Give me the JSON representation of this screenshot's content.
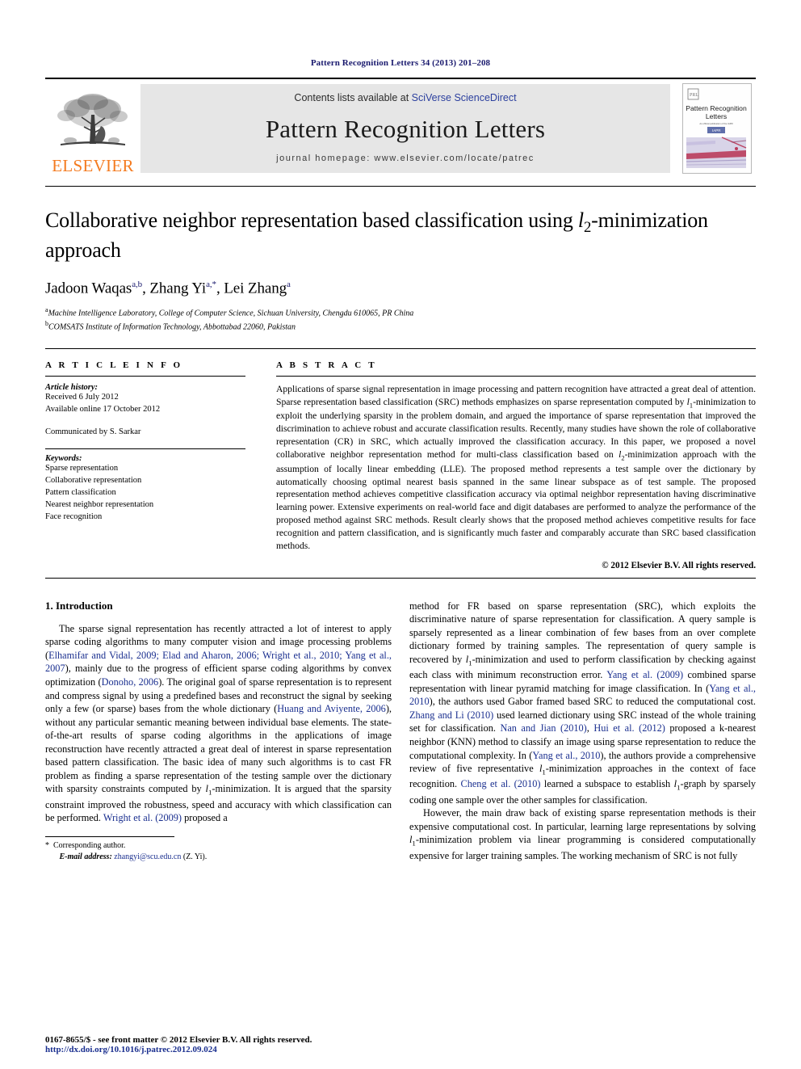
{
  "running_head": "Pattern Recognition Letters 34 (2013) 201–208",
  "masthead": {
    "contents_prefix": "Contents lists available at ",
    "sciencedirect_link": "SciVerse ScienceDirect",
    "journal_name": "Pattern Recognition Letters",
    "homepage": "journal homepage: www.elsevier.com/locate/patrec",
    "publisher_wordmark": "ELSEVIER",
    "cover_title_line1": "Pattern Recognition",
    "cover_title_line2": "Letters"
  },
  "article": {
    "title": "Collaborative neighbor representation based classification using l2-minimization approach",
    "title_part1": "Collaborative neighbor representation based classification using ",
    "title_math": "l",
    "title_sub": "2",
    "title_part2": "-minimization approach",
    "authors": "Jadoon Waqas a,b, Zhang Yi a,*, Lei Zhang a",
    "author1": "Jadoon Waqas",
    "author1_sup": "a,b",
    "author2": "Zhang Yi",
    "author2_sup": "a,*",
    "author3": "Lei Zhang",
    "author3_sup": "a",
    "affiliation_a_sup": "a",
    "affiliation_a": "Machine Intelligence Laboratory, College of Computer Science, Sichuan University, Chengdu 610065, PR China",
    "affiliation_b_sup": "b",
    "affiliation_b": "COMSATS Institute of Information Technology, Abbottabad 22060, Pakistan"
  },
  "article_info": {
    "heading": "A R T I C L E   I N F O",
    "history_label": "Article history:",
    "received": "Received 6 July 2012",
    "available_online": "Available online 17 October 2012",
    "communicated_by": "Communicated by S. Sarkar",
    "keywords_label": "Keywords:",
    "keywords": [
      "Sparse representation",
      "Collaborative representation",
      "Pattern classification",
      "Nearest neighbor representation",
      "Face recognition"
    ]
  },
  "abstract": {
    "heading": "A B S T R A C T",
    "text_1": "Applications of sparse signal representation in image processing and pattern recognition have attracted a great deal of attention. Sparse representation based classification (SRC) methods emphasizes on sparse representation computed by ",
    "math_l": "l",
    "sub_1": "1",
    "text_2": "-minimization to exploit the underlying sparsity in the problem domain, and argued the importance of sparse representation that improved the discrimination to achieve robust and accurate classification results. Recently, many studies have shown the role of collaborative representation (CR) in SRC, which actually improved the classification accuracy. In this paper, we proposed a novel collaborative neighbor representation method for multi-class classification based on ",
    "sub_2": "2",
    "text_3": "-minimization approach with the assumption of locally linear embedding (LLE). The proposed method represents a test sample over the dictionary by automatically choosing optimal nearest basis spanned in the same linear subspace as of test sample. The proposed representation method achieves competitive classification accuracy via optimal neighbor representation having discriminative learning power. Extensive experiments on real-world face and digit databases are performed to analyze the performance of the proposed method against SRC methods. Result clearly shows that the proposed method achieves competitive results for face recognition and pattern classification, and is significantly much faster and comparably accurate than SRC based classification methods.",
    "copyright": "© 2012 Elsevier B.V. All rights reserved."
  },
  "introduction": {
    "heading": "1. Introduction",
    "left_p1_a": "The sparse signal representation has recently attracted a lot of interest to apply sparse coding algorithms to many computer vision and image processing problems (",
    "left_cite_1": "Elhamifar and Vidal, 2009; Elad and Aharon, 2006; Wright et al., 2010; Yang et al., 2007",
    "left_p1_b": "), mainly due to the progress of efficient sparse coding algorithms by convex optimization (",
    "left_cite_2": "Donoho, 2006",
    "left_p1_c": "). The original goal of sparse representation is to represent and compress signal by using a predefined bases and reconstruct the signal by seeking only a few (or sparse) bases from the whole dictionary (",
    "left_cite_3": "Huang and Aviyente, 2006",
    "left_p1_d": "), without any particular semantic meaning between individual base elements. The state-of-the-art results of sparse coding algorithms in the applications of image reconstruction have recently attracted a great deal of interest in sparse representation based pattern classification. The basic idea of many such algorithms is to cast FR problem as finding a sparse representation of the testing sample over the dictionary with sparsity constraints computed by ",
    "left_math_l": "l",
    "left_sub_1": "1",
    "left_p1_e": "-minimization. It is argued that the sparsity constraint improved the robustness, speed and accuracy with which classification can be performed. ",
    "left_cite_4": "Wright et al. (2009)",
    "left_p1_f": " proposed a",
    "right_p1_a": "method for FR based on sparse representation (SRC), which exploits the discriminative nature of sparse representation for classification. A query sample is sparsely represented as a linear combination of few bases from an over complete dictionary formed by training samples. The representation of query sample is recovered by ",
    "right_sub_1": "1",
    "right_p1_b": "-minimization and used to perform classification by checking against each class with minimum reconstruction error. ",
    "right_cite_1": "Yang et al. (2009)",
    "right_p1_c": " combined sparse representation with linear pyramid matching for image classification. In (",
    "right_cite_2": "Yang et al., 2010",
    "right_p1_d": "), the authors used Gabor framed based SRC to reduced the computational cost. ",
    "right_cite_3": "Zhang and Li (2010)",
    "right_p1_e": " used learned dictionary using SRC instead of the whole training set for classification. ",
    "right_cite_4": "Nan and Jian (2010)",
    "right_p1_f": ", ",
    "right_cite_5": "Hui et al. (2012)",
    "right_p1_g": " proposed a k-nearest neighbor (KNN) method to classify an image using sparse representation to reduce the computational complexity. In (",
    "right_cite_6": "Yang et al., 2010",
    "right_p1_h": "), the authors provide a comprehensive review of five representative ",
    "right_sub_2": "1",
    "right_p1_i": "-minimization approaches in the context of face recognition. ",
    "right_cite_7": "Cheng et al. (2010)",
    "right_p1_j": " learned a subspace to establish ",
    "right_sub_3": "1",
    "right_p1_k": "-graph by sparsely coding one sample over the other samples for classification.",
    "right_p2_a": "However, the main draw back of existing sparse representation methods is their expensive computational cost. In particular, learning large representations by solving ",
    "right_sub_4": "1",
    "right_p2_b": "-minimization problem via linear programming is considered computationally expensive for larger training samples. The working mechanism of SRC is not fully"
  },
  "footnote": {
    "star": "*",
    "corresponding": "Corresponding author.",
    "email_label": "E-mail address:",
    "email": "zhangyi@scu.edu.cn",
    "email_suffix": "(Z. Yi)."
  },
  "footer": {
    "issn_line": "0167-8655/$ - see front matter © 2012 Elsevier B.V. All rights reserved.",
    "doi_line": "http://dx.doi.org/10.1016/j.patrec.2012.09.024"
  },
  "colors": {
    "link_blue": "#1a2f8f",
    "running_head_blue": "#1a1a6e",
    "elsevier_orange": "#f47b20",
    "band_gray": "#e6e6e6"
  }
}
